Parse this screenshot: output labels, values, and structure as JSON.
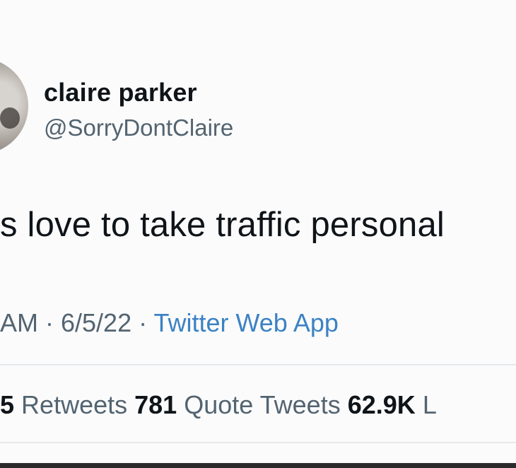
{
  "author": {
    "display_name": "claire parker",
    "handle": "@SorryDontClaire"
  },
  "tweet": {
    "text": "s love to take traffic personal"
  },
  "meta": {
    "time_partial": "AM",
    "separator_1": " · ",
    "date": "6/5/22",
    "separator_2": " · ",
    "source": "Twitter Web App"
  },
  "stats": {
    "retweets_count": "5",
    "retweets_label": "Retweets",
    "quote_tweets_count": "781",
    "quote_tweets_label": "Quote Tweets",
    "likes_count": "62.9K",
    "likes_label": "L"
  },
  "colors": {
    "background": "#fbfbfb",
    "text_primary": "#0f1419",
    "text_secondary": "#536471",
    "link": "#3c82c4",
    "divider": "#e6e9ec"
  }
}
